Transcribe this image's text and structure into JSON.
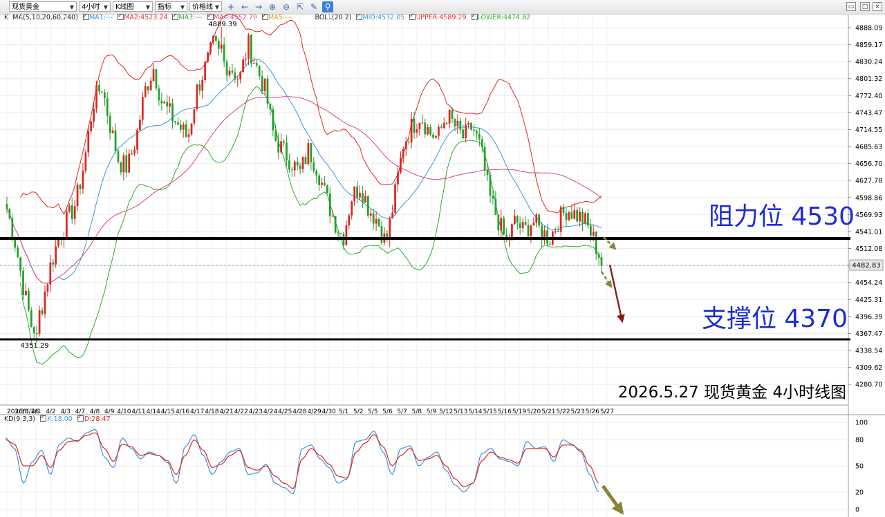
{
  "toolbar": {
    "symbol": "现货黄金",
    "period": "4小时",
    "chart_style": "K线图",
    "indicator": "指标",
    "price_line": "价格线"
  },
  "legend": {
    "k_label": "K",
    "ma_title": "MA(5,10,20,60,240)",
    "ma1": "MA1:---",
    "ma2": "MA2:4523.24",
    "ma3": "MA3:---",
    "ma4": "MA4:4552.79",
    "ma5": "MA5:---",
    "boll_title": "BOLL(20,2)",
    "mid": "MID:4532.05",
    "upper": "UPPER:4589.29",
    "lower": "LOWER:4474.82"
  },
  "kd_legend": {
    "title": "KD(9,3,3)",
    "k": "K:18.00",
    "d": "D:28.47"
  },
  "colors": {
    "up": "#e0261f",
    "down": "#22a02c",
    "ma2": "#e23030",
    "ma4": "#d8477a",
    "boll_mid": "#3d93dd",
    "boll_upper": "#e0261f",
    "boll_lower": "#2fa82f",
    "kd_k": "#3d93dd",
    "kd_d": "#e0261f",
    "level_line": "#000000",
    "annotation_text": "#1d2bd6",
    "arrow_dark": "#8b1a1a",
    "arrow_olive": "#8a8237",
    "last_price_bg": "#e9e9e9"
  },
  "annotations": {
    "resistance": "阻力位 4530",
    "support": "支撑位 4370",
    "caption": "2026.5.27 现货黄金 4小时线图",
    "high_label": "4889.39",
    "low_label": "4351.29",
    "last_price": "4482.83"
  },
  "chart_data": [
    {
      "type": "candlestick",
      "title": "",
      "y_ticks": [
        "4888.09",
        "4859.17",
        "4830.24",
        "4801.32",
        "4772.40",
        "4743.47",
        "4714.55",
        "4685.63",
        "4656.70",
        "4627.78",
        "4598.86",
        "4569.93",
        "4541.01",
        "4512.08",
        "4483.16",
        "4454.24",
        "4425.31",
        "4396.39",
        "4367.47",
        "4338.54",
        "4309.62",
        "4280.70"
      ],
      "x_ticks": [
        "2026/3/26",
        "3/30",
        "4/1",
        "4/2",
        "4/3",
        "4/7",
        "4/8",
        "4/9",
        "4/10",
        "4/11",
        "4/14",
        "4/15",
        "4/16",
        "4/17",
        "4/18",
        "4/21",
        "4/22",
        "4/23",
        "4/24",
        "4/25",
        "4/28",
        "4/29",
        "4/30",
        "5/1",
        "5/2",
        "5/5",
        "5/6",
        "5/7",
        "5/8",
        "5/9",
        "5/12",
        "5/13",
        "5/14",
        "5/15",
        "5/16",
        "5/19",
        "5/20",
        "5/21",
        "5/22",
        "5/23",
        "5/26",
        "5/27"
      ],
      "ylim": [
        4270,
        4900
      ],
      "close_path": [
        4580,
        4520,
        4440,
        4370,
        4410,
        4480,
        4530,
        4560,
        4590,
        4660,
        4760,
        4790,
        4720,
        4660,
        4650,
        4700,
        4780,
        4820,
        4760,
        4740,
        4720,
        4700,
        4780,
        4820,
        4860,
        4830,
        4820,
        4800,
        4860,
        4820,
        4780,
        4700,
        4680,
        4660,
        4640,
        4680,
        4650,
        4600,
        4560,
        4530,
        4600,
        4620,
        4580,
        4560,
        4520,
        4600,
        4690,
        4720,
        4740,
        4710,
        4700,
        4740,
        4720,
        4700,
        4720,
        4680,
        4600,
        4560,
        4520,
        4560,
        4540,
        4560,
        4540,
        4530,
        4560,
        4580,
        4570,
        4560,
        4530,
        4490
      ],
      "high": 4889.39,
      "low": 4351.29,
      "last": 4482.83,
      "moving_averages": {
        "MA2": 4523.24,
        "MA4": 4552.79
      },
      "bollinger": {
        "MID": 4532.05,
        "UPPER": 4589.29,
        "LOWER": 4474.82
      },
      "levels": [
        {
          "label": "阻力位 4530",
          "value": 4530
        },
        {
          "label": "支撑位 4370",
          "value": 4370
        }
      ]
    },
    {
      "type": "line",
      "title": "KD(9,3,3)",
      "y_ticks": [
        "100",
        "80",
        "50",
        "20",
        "0"
      ],
      "ylim": [
        0,
        100
      ],
      "series": [
        {
          "name": "K",
          "last": 18.0,
          "values": [
            82,
            70,
            30,
            55,
            68,
            40,
            75,
            82,
            78,
            88,
            92,
            60,
            48,
            82,
            70,
            58,
            66,
            62,
            54,
            30,
            72,
            86,
            62,
            40,
            55,
            66,
            70,
            40,
            42,
            52,
            30,
            25,
            18,
            70,
            74,
            58,
            48,
            30,
            35,
            78,
            80,
            90,
            66,
            40,
            70,
            73,
            50,
            60,
            66,
            45,
            28,
            20,
            30,
            64,
            70,
            58,
            55,
            50,
            78,
            70,
            72,
            55,
            80,
            75,
            66,
            40,
            20
          ]
        },
        {
          "name": "D",
          "last": 28.47,
          "values": [
            80,
            75,
            50,
            50,
            62,
            48,
            68,
            78,
            79,
            85,
            88,
            70,
            55,
            75,
            72,
            62,
            64,
            62,
            56,
            40,
            62,
            80,
            68,
            48,
            52,
            62,
            68,
            48,
            45,
            50,
            38,
            30,
            24,
            58,
            70,
            62,
            52,
            38,
            36,
            66,
            76,
            86,
            72,
            50,
            62,
            70,
            56,
            58,
            62,
            50,
            35,
            26,
            30,
            56,
            66,
            60,
            57,
            53,
            70,
            70,
            70,
            60,
            74,
            74,
            68,
            50,
            30
          ]
        }
      ]
    }
  ]
}
